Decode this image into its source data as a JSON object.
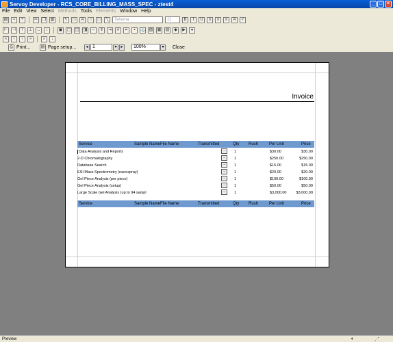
{
  "window": {
    "title": "Servoy Developer - RCS_CORE_BILLING_MASS_SPEC - ztest4"
  },
  "menu": [
    "File",
    "Edit",
    "View",
    "Select",
    "Methods",
    "Tools",
    "Elements",
    "Window",
    "Help"
  ],
  "menu_disabled": [
    "Methods",
    "Elements"
  ],
  "toolbar": {
    "font_name": "Tahoma",
    "font_size": "11"
  },
  "print_bar": {
    "print_label": "Print...",
    "page_setup_label": "Page setup...",
    "page_value": "1",
    "zoom_value": "100%",
    "close_label": "Close"
  },
  "report": {
    "title": "Invoice",
    "columns": [
      "Service",
      "Sample Name",
      "File Name",
      "Transmitted",
      "Qty",
      "Rush",
      "Per Unit",
      "Price"
    ],
    "rows": [
      {
        "service": "Data Analysis and Reports",
        "qty": "1",
        "per_unit": "$30.00",
        "price": "$30.00"
      },
      {
        "service": "2-D Chromatography",
        "qty": "1",
        "per_unit": "$250.00",
        "price": "$250.00"
      },
      {
        "service": "Database Search",
        "qty": "1",
        "per_unit": "$15.00",
        "price": "$15.00"
      },
      {
        "service": "ESI Mass Spectrometry (nanospray)",
        "qty": "1",
        "per_unit": "$20.00",
        "price": "$20.00"
      },
      {
        "service": "Gel Piece Analysis (per piece)",
        "qty": "1",
        "per_unit": "$100.00",
        "price": "$100.00"
      },
      {
        "service": "Gel Piece Analysis (setup)",
        "qty": "1",
        "per_unit": "$50.00",
        "price": "$50.00"
      },
      {
        "service": "Large Scale Gel Analysis (up to 94 sampl",
        "qty": "1",
        "per_unit": "$3,000.00",
        "price": "$3,000.00"
      }
    ],
    "transmitted_button": "..."
  },
  "status": {
    "mode": "Preview"
  },
  "colors": {
    "header_band": "#6f9ad0",
    "canvas": "#808080",
    "titlebar": "#0a5fd8"
  }
}
